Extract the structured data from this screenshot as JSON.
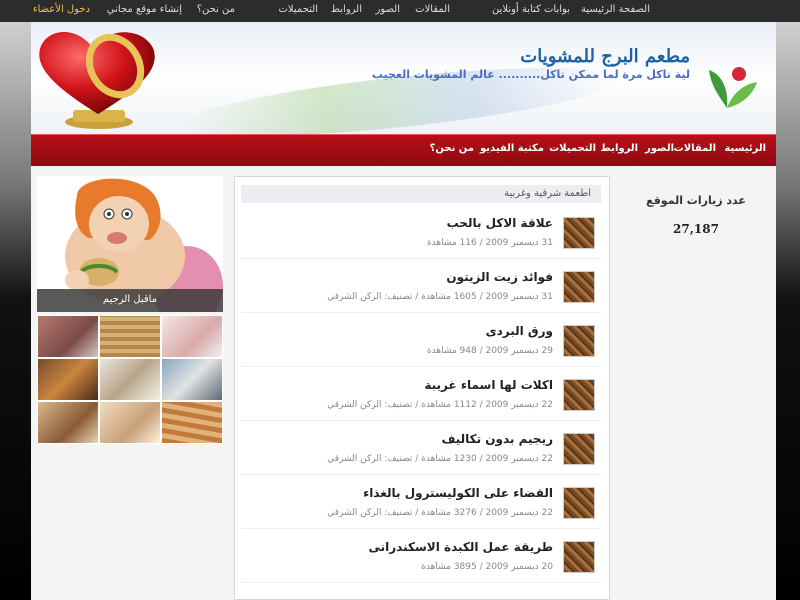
{
  "topbar": {
    "home": "الصفحة الرئيسية",
    "portals": "بوابات كتابة أونلاين",
    "articles": "المقالات",
    "images": "الصور",
    "links": "الروابط",
    "downloads": "التحميلات",
    "about": "من نحن؟",
    "create_site": "إنشاء موقع مجاني",
    "member_login": "دخول الأعضاء"
  },
  "header": {
    "site_title": "مطعم البرج للمشويات",
    "slogan": "لية تاكل مرة لما ممكن تاكل.......... عالم المشويات العجيب"
  },
  "nav": {
    "items": [
      "الرئيسية",
      "المقالات",
      "الصور",
      "الروابط",
      "التحميلات",
      "مكتبة الفيديو",
      "من نحن؟"
    ]
  },
  "sidebar_left": {
    "cartoon_caption": "ماقبل الرجيم"
  },
  "main": {
    "category": "اطعمة شرقية وغربية",
    "articles": [
      {
        "title": "علاقة الاكل بالحب",
        "meta": "31 ديسمبر 2009 / 116 مشاهدة"
      },
      {
        "title": "فوائد زيت الزيتون",
        "meta": "31 ديسمبر 2009 / 1605 مشاهدة / تصنيف: الركن الشرقي"
      },
      {
        "title": "ورق البردى",
        "meta": "29 ديسمبر 2009 / 948 مشاهدة"
      },
      {
        "title": "اكلات لها اسماء غريبة",
        "meta": "22 ديسمبر 2009 / 1112 مشاهدة / تصنيف: الركن الشرقي"
      },
      {
        "title": "ريجيم بدون تكاليف",
        "meta": "22 ديسمبر 2009 / 1230 مشاهدة / تصنيف: الركن الشرقي"
      },
      {
        "title": "القضاء على الكوليسترول بالغذاء",
        "meta": "22 ديسمبر 2009 / 3276 مشاهدة / تصنيف: الركن الشرقي"
      },
      {
        "title": "طريقة عمل الكبدة الاسكندرانى",
        "meta": "20 ديسمبر 2009 / 3895 مشاهدة"
      }
    ]
  },
  "sidebar_right": {
    "visits_label": "عدد زيارات الموقع",
    "visits_count": "27,187"
  },
  "colors": {
    "nav_red": "#b80f17",
    "title_blue": "#1b63a6",
    "member_gold": "#f2c53d"
  }
}
